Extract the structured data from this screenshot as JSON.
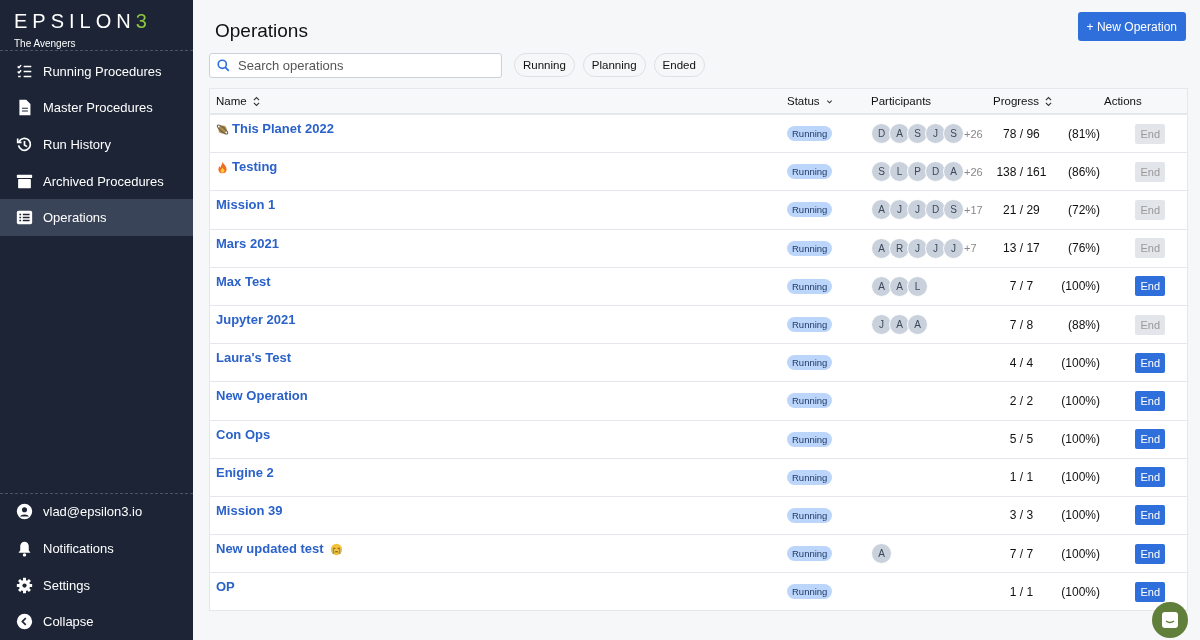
{
  "sidebar": {
    "logo": {
      "left": "EPSILON",
      "accent": "3"
    },
    "team": "The Avengers",
    "items": [
      {
        "label": "Running Procedures",
        "selected": false
      },
      {
        "label": "Master Procedures",
        "selected": false
      },
      {
        "label": "Run History",
        "selected": false
      },
      {
        "label": "Archived Procedures",
        "selected": false
      },
      {
        "label": "Operations",
        "selected": true
      }
    ],
    "footer": [
      "vlad@epsilon3.io",
      "Notifications",
      "Settings",
      "Collapse"
    ]
  },
  "page": {
    "title": "Operations",
    "new_button": "+ New Operation"
  },
  "search": {
    "placeholder": "Search operations"
  },
  "filters": [
    {
      "label": "Running",
      "selected": false
    },
    {
      "label": "Planning",
      "selected": false
    },
    {
      "label": "Ended",
      "selected": false
    }
  ],
  "table": {
    "columns": [
      "Name",
      "Status",
      "Participants",
      "Progress",
      "Actions"
    ],
    "rows": [
      {
        "name": "This Planet 2022",
        "status": "Running",
        "participants": [
          "D",
          "A",
          "S",
          "J",
          "S"
        ],
        "more": "+26",
        "count": "78 / 96",
        "percent": "(81%)",
        "action": "End",
        "disabled": true
      },
      {
        "name": "Testing",
        "status": "Running",
        "participants": [
          "S",
          "L",
          "P",
          "D",
          "A"
        ],
        "more": "+26",
        "count": "138 / 161",
        "percent": "(86%)",
        "action": "End",
        "disabled": true
      },
      {
        "name": "Mission 1",
        "status": "Running",
        "participants": [
          "A",
          "J",
          "J",
          "D",
          "S"
        ],
        "more": "+17",
        "count": "21 / 29",
        "percent": "(72%)",
        "action": "End",
        "disabled": true
      },
      {
        "name": "Mars 2021",
        "status": "Running",
        "participants": [
          "A",
          "R",
          "J",
          "J",
          "J"
        ],
        "more": "+7",
        "count": "13 / 17",
        "percent": "(76%)",
        "action": "End",
        "disabled": true
      },
      {
        "name": "Max Test",
        "status": "Running",
        "participants": [
          "A",
          "A",
          "L"
        ],
        "count": "7 / 7",
        "percent": "(100%)",
        "action": "End",
        "disabled": false
      },
      {
        "name": "Jupyter 2021",
        "status": "Running",
        "participants": [
          "J",
          "A",
          "A"
        ],
        "count": "7 / 8",
        "percent": "(88%)",
        "action": "End",
        "disabled": true
      },
      {
        "name": "Laura's Test",
        "status": "Running",
        "count": "4 / 4",
        "percent": "(100%)",
        "action": "End",
        "disabled": false
      },
      {
        "name": "New Operation",
        "status": "Running",
        "count": "2 / 2",
        "percent": "(100%)",
        "action": "End",
        "disabled": false
      },
      {
        "name": "Con Ops",
        "status": "Running",
        "count": "5 / 5",
        "percent": "(100%)",
        "action": "End",
        "disabled": false
      },
      {
        "name": "Enigine 2",
        "status": "Running",
        "count": "1 / 1",
        "percent": "(100%)",
        "action": "End",
        "disabled": false
      },
      {
        "name": "Mission 39",
        "status": "Running",
        "count": "3 / 3",
        "percent": "(100%)",
        "action": "End",
        "disabled": false
      },
      {
        "name": "New updated test",
        "status": "Running",
        "participants": [
          "A"
        ],
        "count": "7 / 7",
        "percent": "(100%)",
        "action": "End",
        "disabled": false
      },
      {
        "name": "OP",
        "status": "Running",
        "count": "1 / 1",
        "percent": "(100%)",
        "action": "End",
        "disabled": false
      }
    ]
  }
}
